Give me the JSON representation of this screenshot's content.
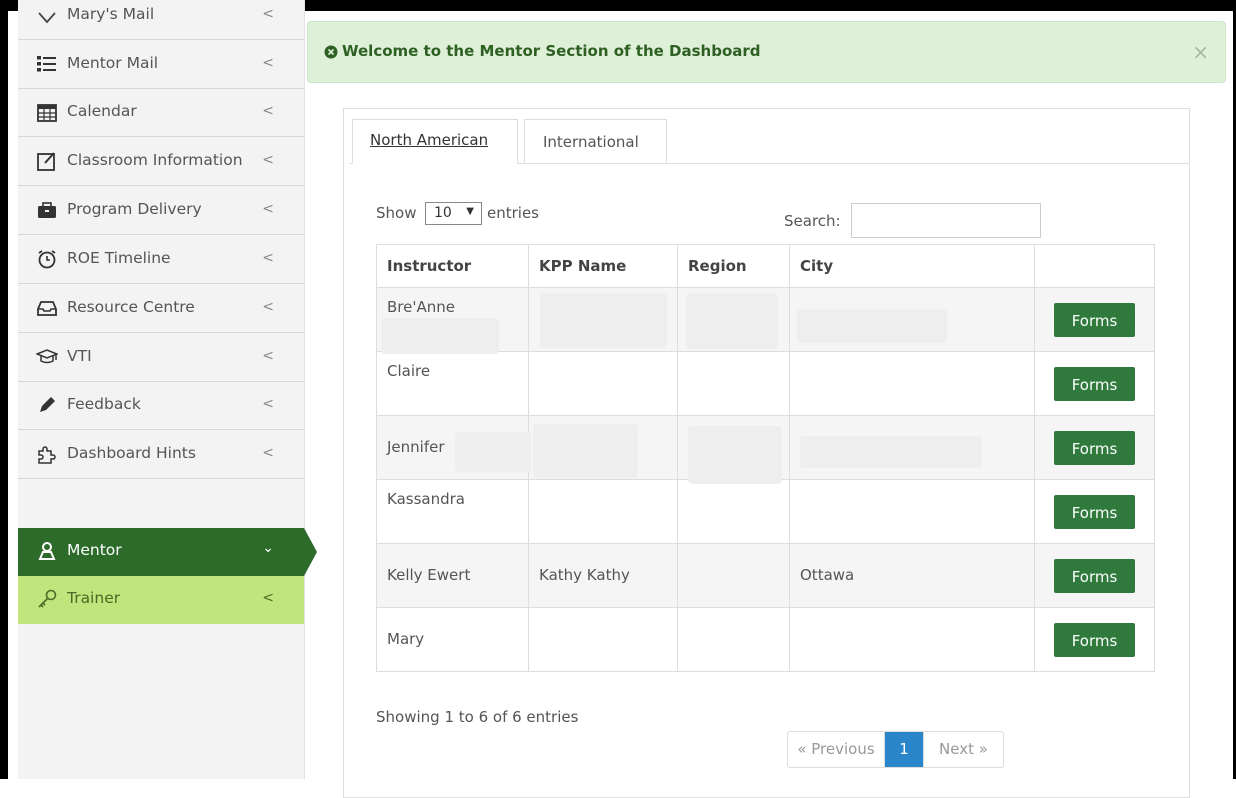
{
  "sidebar": {
    "items": [
      {
        "label": "Mary's Mail",
        "icon": "heart-icon"
      },
      {
        "label": "Mentor Mail",
        "icon": "list-icon"
      },
      {
        "label": "Calendar",
        "icon": "calendar-icon"
      },
      {
        "label": "Classroom Information",
        "icon": "edit-icon"
      },
      {
        "label": "Program Delivery",
        "icon": "briefcase-icon"
      },
      {
        "label": "ROE Timeline",
        "icon": "clock-icon"
      },
      {
        "label": "Resource Centre",
        "icon": "inbox-icon"
      },
      {
        "label": "VTI",
        "icon": "graduation-cap-icon"
      },
      {
        "label": "Feedback",
        "icon": "pencil-icon"
      },
      {
        "label": "Dashboard Hints",
        "icon": "puzzle-icon"
      },
      {
        "label": "Mentor",
        "icon": "user-icon"
      },
      {
        "label": "Trainer",
        "icon": "key-icon"
      }
    ],
    "active_color": "#2d6b2a",
    "trainer_color": "#bfe57c"
  },
  "alert": {
    "text": "Welcome to the Mentor Section of the Dashboard",
    "close": "×",
    "color": "#dff0d8"
  },
  "tabs": [
    "North American",
    "International"
  ],
  "controls": {
    "show_label": "Show",
    "page_size": "10",
    "entries_label": "entries",
    "search_label": "Search:",
    "search_value": ""
  },
  "table": {
    "columns": [
      "Instructor",
      "KPP Name",
      "Region",
      "City",
      ""
    ],
    "rows": [
      {
        "instructor": "Bre'Anne",
        "kpp": "",
        "region": "",
        "city": "",
        "action": "Forms"
      },
      {
        "instructor": "Claire",
        "kpp": "",
        "region": "",
        "city": "",
        "action": "Forms"
      },
      {
        "instructor": "Jennifer",
        "kpp": "",
        "region": "",
        "city": "",
        "action": "Forms"
      },
      {
        "instructor": "Kassandra",
        "kpp": "",
        "region": "",
        "city": "",
        "action": "Forms"
      },
      {
        "instructor": "Kelly Ewert",
        "kpp": "Kathy Kathy",
        "region": "",
        "city": "Ottawa",
        "action": "Forms"
      },
      {
        "instructor": "Mary",
        "kpp": "",
        "region": "",
        "city": "",
        "action": "Forms"
      }
    ],
    "button_color": "#2f7a3c"
  },
  "footer": {
    "info": "Showing 1 to 6 of 6 entries",
    "prev": "« Previous",
    "current_page": "1",
    "next": "Next »",
    "page_color": "#2a86c8"
  }
}
